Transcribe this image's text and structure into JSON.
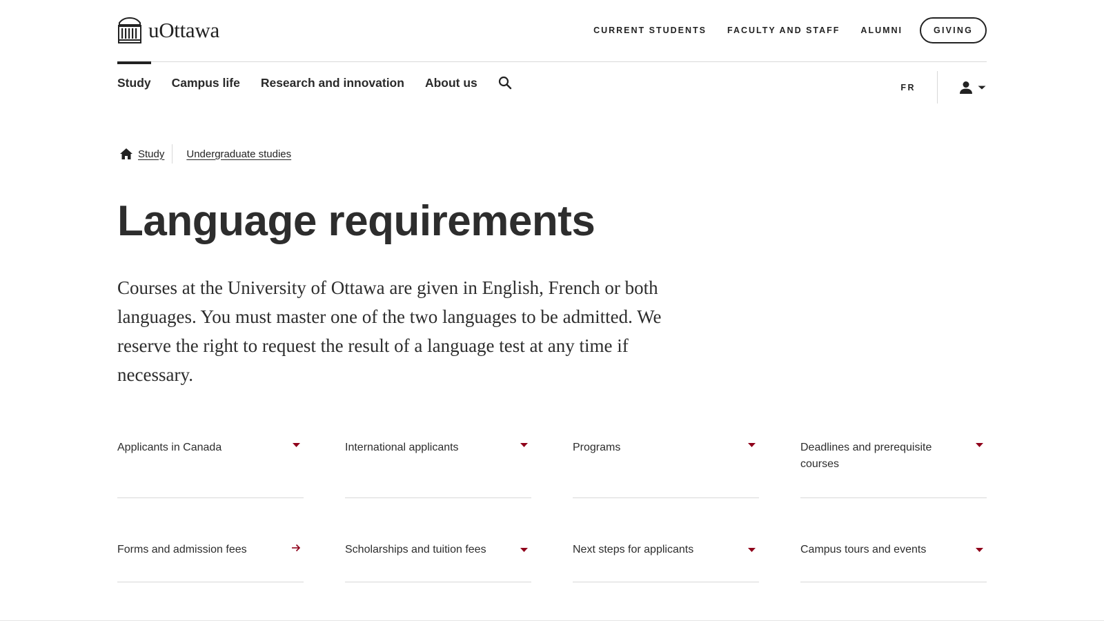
{
  "brand": {
    "logo_text": "uOttawa",
    "icon": "university-building-icon"
  },
  "utility_nav": {
    "current_students": "CURRENT STUDENTS",
    "faculty_and_staff": "FACULTY AND STAFF",
    "alumni": "ALUMNI",
    "giving": "GIVING"
  },
  "main_nav": {
    "items": [
      {
        "label": "Study",
        "active": true
      },
      {
        "label": "Campus life",
        "active": false
      },
      {
        "label": "Research and innovation",
        "active": false
      },
      {
        "label": "About us",
        "active": false
      }
    ],
    "search_icon": "search-icon",
    "language_toggle": "FR",
    "user_icon": "user-icon"
  },
  "breadcrumb": {
    "home_icon": "home-icon",
    "items": [
      "Study",
      "Undergraduate studies"
    ]
  },
  "page": {
    "title": "Language requirements",
    "intro": "Courses at the University of Ottawa are given in English, French or both languages. You must master one of the two languages to be admitted. We reserve the right to request the result of a language test at any time if necessary."
  },
  "cards": [
    {
      "label": "Applicants in Canada",
      "icon": "caret-down-icon"
    },
    {
      "label": "International applicants",
      "icon": "caret-down-icon"
    },
    {
      "label": "Programs",
      "icon": "caret-down-icon"
    },
    {
      "label": "Deadlines and prerequisite courses",
      "icon": "caret-down-icon"
    },
    {
      "label": "Forms and admission fees",
      "icon": "arrow-right-icon"
    },
    {
      "label": "Scholarships and tuition fees",
      "icon": "caret-down-icon"
    },
    {
      "label": "Next steps for applicants",
      "icon": "caret-down-icon"
    },
    {
      "label": "Campus tours and events",
      "icon": "caret-down-icon"
    }
  ],
  "colors": {
    "accent": "#8f001a",
    "text": "#222222",
    "divider": "#d8d8d8"
  }
}
